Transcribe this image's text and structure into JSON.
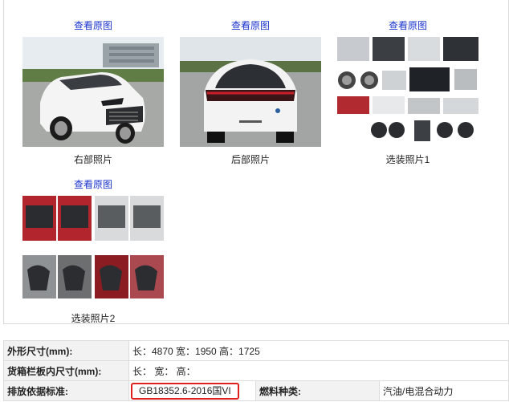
{
  "gallery": {
    "link_label": "查看原图",
    "photos": [
      {
        "caption": "右部照片"
      },
      {
        "caption": "后部照片"
      },
      {
        "caption": "选装照片1"
      },
      {
        "caption": "选装照片2"
      }
    ]
  },
  "specs": {
    "dimensions_label": "外形尺寸(mm):",
    "dimensions_value": "长：4870 宽：1950 高：1725",
    "cargo_label": "货箱栏板内尺寸(mm):",
    "cargo_value": "长： 宽： 高：",
    "emission_label": "排放依据标准:",
    "emission_value": "GB18352.6-2016国VI",
    "fuel_label": "燃料种类:",
    "fuel_value": "汽油/电混合动力"
  },
  "colors": {
    "link": "#1a33cc",
    "highlight_box": "#e02020",
    "label_bg": "#f2f2f2"
  }
}
